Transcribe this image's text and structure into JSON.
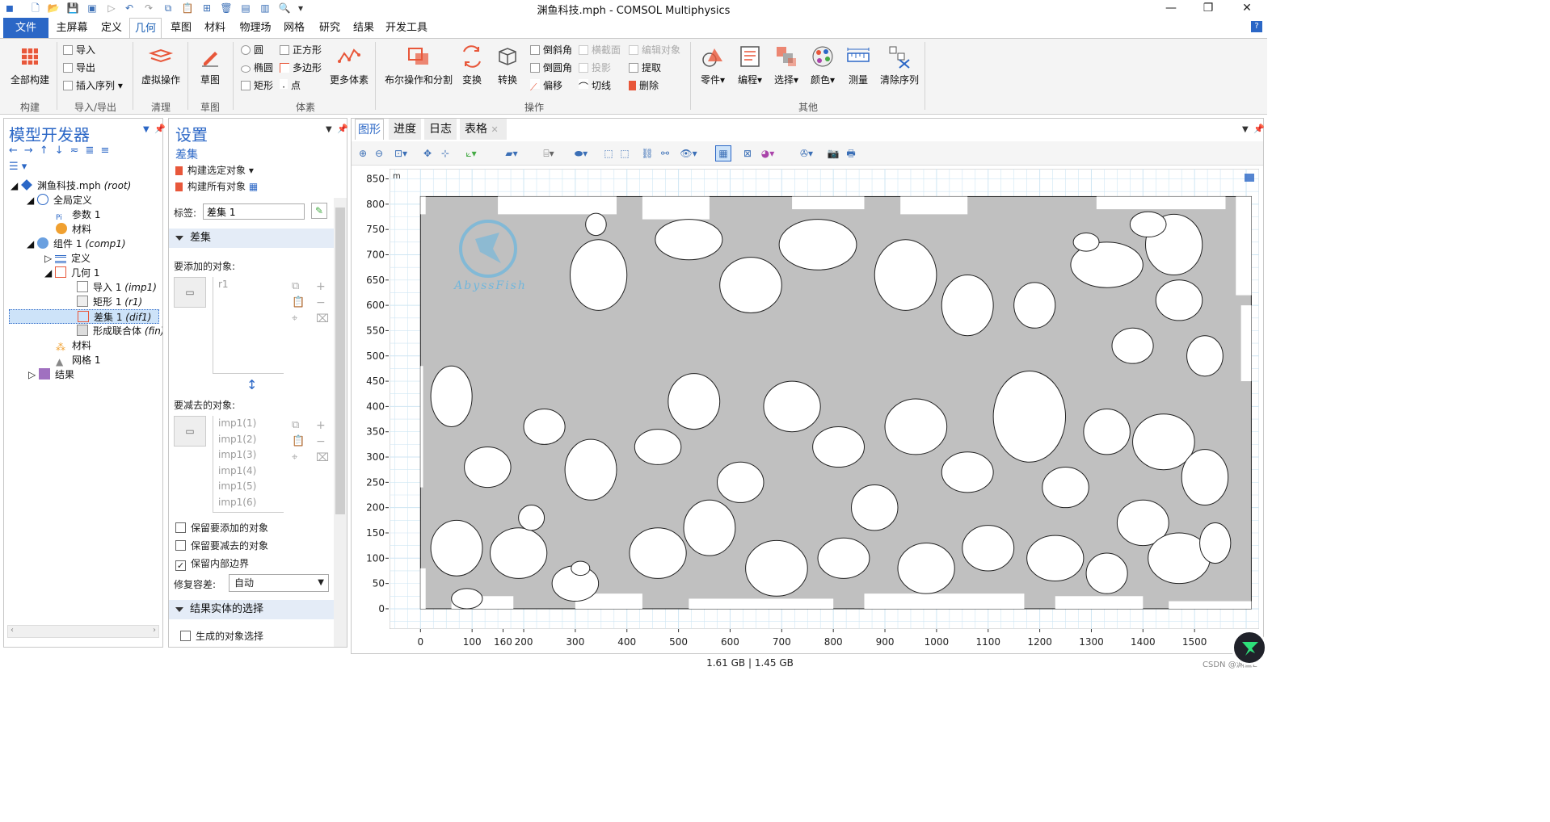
{
  "window": {
    "title": "渊鱼科技.mph - COMSOL Multiphysics",
    "min_label": "—",
    "max_label": "❐",
    "close_label": "✕"
  },
  "menu": {
    "file": "文件",
    "tabs": [
      "主屏幕",
      "定义",
      "几何",
      "草图",
      "材料",
      "物理场",
      "网格",
      "研究",
      "结果",
      "开发工具"
    ],
    "help": "?"
  },
  "ribbon": {
    "build_all": "全部构建",
    "import": "导入",
    "export": "导出",
    "insert_sequence": "插入序列",
    "virtual_ops": "虚拟操作",
    "sketch": "草图",
    "circle": "圆",
    "ellipse": "椭圆",
    "rectangle": "矩形",
    "square": "正方形",
    "polygon": "多边形",
    "point": "点",
    "more_primitives": "更多体素",
    "boolean": "布尔操作和分割",
    "transforms": "变换",
    "conversions": "转换",
    "chamfer": "倒斜角",
    "fillet": "倒圆角",
    "offset": "偏移",
    "cross_section": "横截面",
    "projection": "投影",
    "tangent": "切线",
    "edit_object": "编辑对象",
    "extract": "提取",
    "delete": "删除",
    "parts": "零件",
    "programming": "编程",
    "selections": "选择",
    "colors": "颜色",
    "measure": "测量",
    "clear_sequence": "清除序列",
    "groups": {
      "build": "构建",
      "import_export": "导入/导出",
      "cleanup": "清理",
      "sketch": "草图",
      "primitives": "体素",
      "operations": "操作",
      "other": "其他"
    }
  },
  "model_builder": {
    "title": "模型开发器",
    "tree": [
      {
        "label": "渊鱼科技.mph",
        "tag": "(root)"
      },
      {
        "label": "全局定义",
        "tag": ""
      },
      {
        "label": "参数 1",
        "tag": ""
      },
      {
        "label": "材料",
        "tag": ""
      },
      {
        "label": "组件 1",
        "tag": "(comp1)"
      },
      {
        "label": "定义",
        "tag": ""
      },
      {
        "label": "几何 1",
        "tag": ""
      },
      {
        "label": "导入 1",
        "tag": "(imp1)"
      },
      {
        "label": "矩形 1",
        "tag": "(r1)"
      },
      {
        "label": "差集 1",
        "tag": "(dif1)"
      },
      {
        "label": "形成联合体",
        "tag": "(fin)"
      },
      {
        "label": "材料",
        "tag": ""
      },
      {
        "label": "网格 1",
        "tag": ""
      },
      {
        "label": "结果",
        "tag": ""
      }
    ]
  },
  "settings": {
    "title": "设置",
    "subtitle": "差集",
    "build_selected": "构建选定对象",
    "build_all": "构建所有对象",
    "label_caption": "标签:",
    "label_value": "差集 1",
    "section_difference": "差集",
    "objects_to_add_caption": "要添加的对象:",
    "objects_to_add": [
      "r1"
    ],
    "objects_to_subtract_caption": "要减去的对象:",
    "objects_to_subtract": [
      "imp1(1)",
      "imp1(2)",
      "imp1(3)",
      "imp1(4)",
      "imp1(5)",
      "imp1(6)"
    ],
    "keep_add": "保留要添加的对象",
    "keep_subtract": "保留要减去的对象",
    "keep_interior": "保留内部边界",
    "keep_add_checked": false,
    "keep_subtract_checked": false,
    "keep_interior_checked": true,
    "repair_tolerance_caption": "修复容差:",
    "repair_tolerance_value": "自动",
    "section_resulting": "结果实体的选择",
    "resulting_selection": "生成的对象选择"
  },
  "graphics": {
    "tabs": [
      "图形",
      "进度",
      "日志",
      "表格"
    ],
    "watermark": "AbyssFish",
    "axis_unit": "m",
    "x_ticks": [
      "0",
      "100",
      "200",
      "300",
      "400",
      "500",
      "600",
      "700",
      "800",
      "900",
      "1000",
      "1100",
      "1200",
      "1300",
      "1400",
      "1500",
      "160"
    ],
    "y_ticks": [
      "850",
      "800",
      "750",
      "700",
      "650",
      "600",
      "550",
      "500",
      "450",
      "400",
      "350",
      "300",
      "250",
      "200",
      "150",
      "100",
      "50",
      "0"
    ],
    "x_range": [
      -60,
      1625
    ],
    "y_range": [
      -40,
      870
    ],
    "domain_fill": "#c0c0c0",
    "grid_color": "#cfe6f3"
  },
  "status": {
    "memory": "1.61 GB | 1.45 GB",
    "credit": "CSDN @渊鱼L"
  }
}
